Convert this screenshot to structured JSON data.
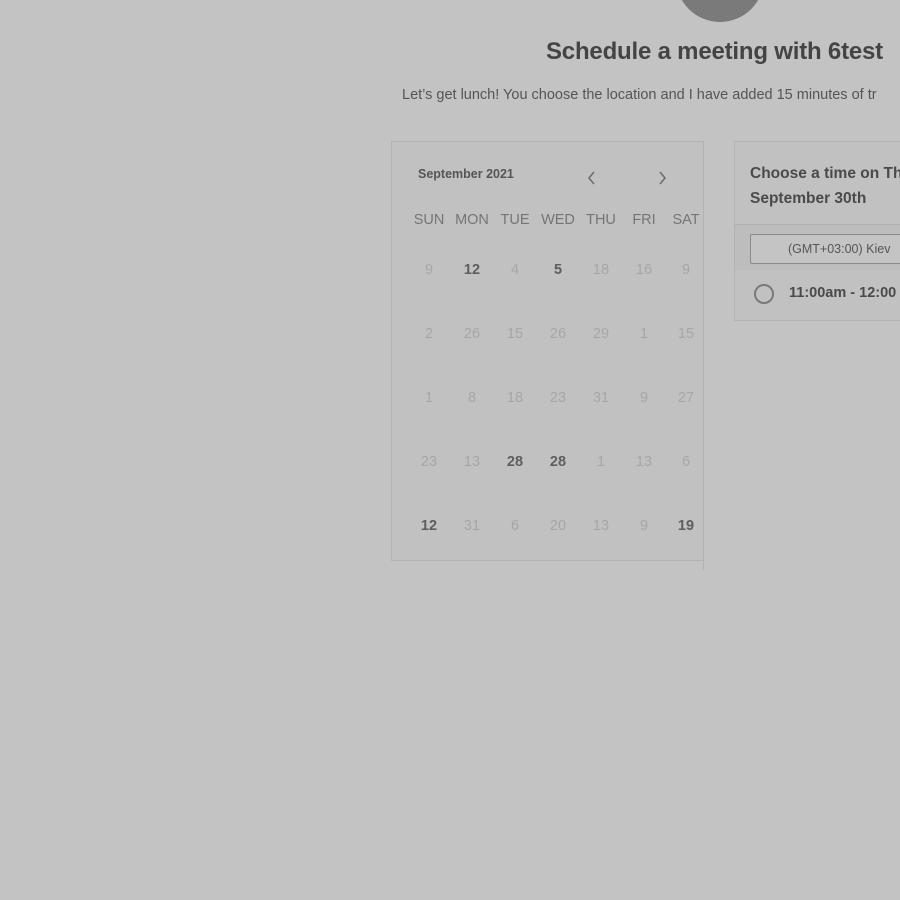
{
  "header": {
    "title": "Schedule a meeting with 6test",
    "description": "Let’s get lunch! You choose the location and I have added 15 minutes of tr"
  },
  "calendar": {
    "month_label": "September 2021",
    "prev_icon": "chevron-left-icon",
    "next_icon": "chevron-right-icon",
    "weekdays": [
      "SUN",
      "MON",
      "TUE",
      "WED",
      "THU",
      "FRI",
      "SAT"
    ],
    "weeks": [
      [
        {
          "label": "9",
          "available": false
        },
        {
          "label": "12",
          "available": true
        },
        {
          "label": "4",
          "available": false
        },
        {
          "label": "5",
          "available": true
        },
        {
          "label": "18",
          "available": false
        },
        {
          "label": "16",
          "available": false
        },
        {
          "label": "9",
          "available": false
        }
      ],
      [
        {
          "label": "2",
          "available": false
        },
        {
          "label": "26",
          "available": false
        },
        {
          "label": "15",
          "available": false
        },
        {
          "label": "26",
          "available": false
        },
        {
          "label": "29",
          "available": false
        },
        {
          "label": "1",
          "available": false
        },
        {
          "label": "15",
          "available": false
        }
      ],
      [
        {
          "label": "1",
          "available": false
        },
        {
          "label": "8",
          "available": false
        },
        {
          "label": "18",
          "available": false
        },
        {
          "label": "23",
          "available": false
        },
        {
          "label": "31",
          "available": false
        },
        {
          "label": "9",
          "available": false
        },
        {
          "label": "27",
          "available": false
        }
      ],
      [
        {
          "label": "23",
          "available": false
        },
        {
          "label": "13",
          "available": false
        },
        {
          "label": "28",
          "available": true
        },
        {
          "label": "28",
          "available": true
        },
        {
          "label": "1",
          "available": false
        },
        {
          "label": "13",
          "available": false
        },
        {
          "label": "6",
          "available": false
        }
      ],
      [
        {
          "label": "12",
          "available": true
        },
        {
          "label": "31",
          "available": false
        },
        {
          "label": "6",
          "available": false
        },
        {
          "label": "20",
          "available": false
        },
        {
          "label": "13",
          "available": false
        },
        {
          "label": "9",
          "available": false
        },
        {
          "label": "19",
          "available": true
        }
      ]
    ]
  },
  "time_panel": {
    "heading_line1": "Choose a time on Th",
    "heading_line2": "September 30th",
    "timezone": "(GMT+03:00) Kiev",
    "slots": [
      {
        "label": "11:00am - 12:00",
        "selected": false
      }
    ]
  }
}
